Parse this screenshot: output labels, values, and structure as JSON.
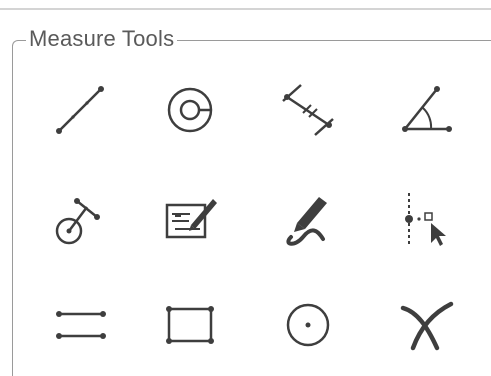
{
  "panel": {
    "title": "Measure Tools"
  },
  "tools": [
    {
      "name": "line-measure-icon"
    },
    {
      "name": "circle-radius-icon"
    },
    {
      "name": "parallel-distance-icon"
    },
    {
      "name": "angle-measure-icon"
    },
    {
      "name": "circle-tangent-icon"
    },
    {
      "name": "annotation-note-icon"
    },
    {
      "name": "freehand-draw-icon"
    },
    {
      "name": "point-to-line-icon"
    },
    {
      "name": "parallel-lines-icon"
    },
    {
      "name": "rectangle-icon"
    },
    {
      "name": "circle-center-icon"
    },
    {
      "name": "curve-x-icon"
    }
  ],
  "colors": {
    "icon": "#3e3e3e",
    "border": "#9a9a9a",
    "title": "#5a5a5a"
  }
}
